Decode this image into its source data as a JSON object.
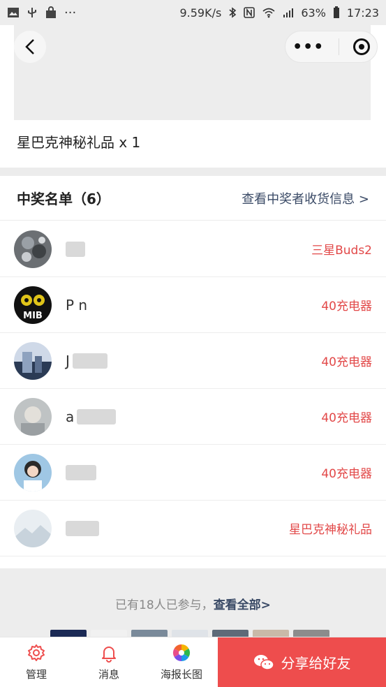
{
  "status_bar": {
    "speed": "9.59K/s",
    "battery": "63%",
    "time": "17:23",
    "left_icons": [
      "image-icon",
      "usb-icon",
      "bag-icon",
      "more-icon"
    ],
    "right_icons": [
      "bluetooth-icon",
      "nfc-icon",
      "wifi-icon",
      "signal-icon",
      "battery-icon"
    ]
  },
  "nav": {
    "back_icon": "chevron-left-icon",
    "more_icon": "more-dots-icon",
    "close_icon": "target-icon"
  },
  "prize": {
    "text": "星巴克神秘礼品 x 1"
  },
  "winners": {
    "title": "中奖名单（6）",
    "link": "查看中奖者收货信息 >",
    "rows": [
      {
        "name": "",
        "prize": "三星Buds2",
        "avatar": "avatar-1"
      },
      {
        "name": "P      n",
        "prize": "40充电器",
        "avatar": "avatar-2"
      },
      {
        "name": "J",
        "prize": "40充电器",
        "avatar": "avatar-3"
      },
      {
        "name": "a",
        "prize": "40充电器",
        "avatar": "avatar-4"
      },
      {
        "name": "",
        "prize": "40充电器",
        "avatar": "avatar-5"
      },
      {
        "name": "",
        "prize": "星巴克神秘礼品",
        "avatar": "avatar-6"
      }
    ]
  },
  "participants": {
    "text": "已有18人已参与，",
    "link": "查看全部>"
  },
  "bottom_bar": {
    "tabs": [
      {
        "label": "管理",
        "icon": "gear-icon"
      },
      {
        "label": "消息",
        "icon": "bell-icon"
      },
      {
        "label": "海报长图",
        "icon": "poster-icon"
      }
    ],
    "share_label": "分享给好友",
    "share_icon": "wechat-icon",
    "accent": "#ee4d4d"
  }
}
